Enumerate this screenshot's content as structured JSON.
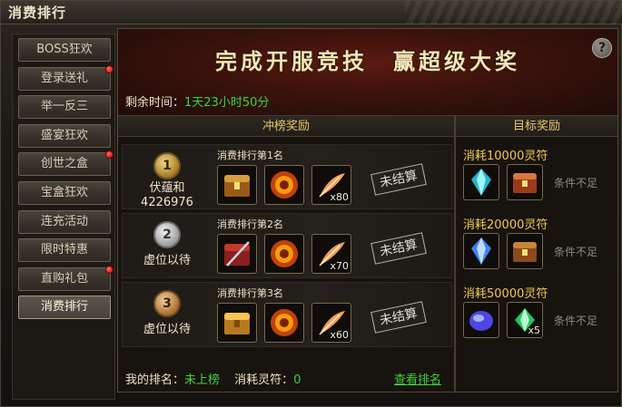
{
  "window": {
    "title": "消费排行"
  },
  "sidebar": {
    "items": [
      {
        "label": "BOSS狂欢",
        "dot": false,
        "active": false
      },
      {
        "label": "登录送礼",
        "dot": true,
        "active": false
      },
      {
        "label": "举一反三",
        "dot": false,
        "active": false
      },
      {
        "label": "盛宴狂欢",
        "dot": false,
        "active": false
      },
      {
        "label": "创世之盒",
        "dot": true,
        "active": false
      },
      {
        "label": "宝盒狂欢",
        "dot": false,
        "active": false
      },
      {
        "label": "连充活动",
        "dot": false,
        "active": false
      },
      {
        "label": "限时特惠",
        "dot": false,
        "active": false
      },
      {
        "label": "直购礼包",
        "dot": true,
        "active": false
      },
      {
        "label": "消费排行",
        "dot": false,
        "active": true
      }
    ]
  },
  "banner": {
    "slogan": "完成开服竞技　赢超级大奖",
    "help": "?"
  },
  "remain": {
    "label": "剩余时间：",
    "value": "1天23小时50分"
  },
  "columns": {
    "left": "冲榜奖励",
    "right": "目标奖励"
  },
  "ranks": [
    {
      "medal": "1",
      "name": "伏蕴和",
      "score": "4226976",
      "title": "消费排行第1名",
      "items": [
        {
          "icon": "chest-icon",
          "count": ""
        },
        {
          "icon": "orb-icon",
          "count": ""
        },
        {
          "icon": "feather-icon",
          "count": "x80"
        }
      ],
      "status": "未结算"
    },
    {
      "medal": "2",
      "name": "虚位以待",
      "score": "",
      "title": "消费排行第2名",
      "items": [
        {
          "icon": "sword-chest-icon",
          "count": ""
        },
        {
          "icon": "orb-icon",
          "count": ""
        },
        {
          "icon": "feather-icon",
          "count": "x70"
        }
      ],
      "status": "未结算"
    },
    {
      "medal": "3",
      "name": "虚位以待",
      "score": "",
      "title": "消费排行第3名",
      "items": [
        {
          "icon": "gold-chest-icon",
          "count": ""
        },
        {
          "icon": "orb-icon",
          "count": ""
        },
        {
          "icon": "feather-icon",
          "count": "x60"
        }
      ],
      "status": "未结算"
    }
  ],
  "targets": [
    {
      "title": "消耗10000灵符",
      "items": [
        {
          "icon": "crystal-icon",
          "count": ""
        },
        {
          "icon": "chest-icon",
          "count": ""
        }
      ],
      "status": "条件不足"
    },
    {
      "title": "消耗20000灵符",
      "items": [
        {
          "icon": "crystal-icon",
          "count": ""
        },
        {
          "icon": "chest-icon",
          "count": ""
        }
      ],
      "status": "条件不足"
    },
    {
      "title": "消耗50000灵符",
      "items": [
        {
          "icon": "gem-icon",
          "count": ""
        },
        {
          "icon": "green-gem-icon",
          "count": "x5"
        }
      ],
      "status": "条件不足"
    }
  ],
  "footer": {
    "rank_label": "我的排名：",
    "rank_value": "未上榜",
    "spent_label": "消耗灵符：",
    "spent_value": "0",
    "view_rank": "查看排名"
  }
}
